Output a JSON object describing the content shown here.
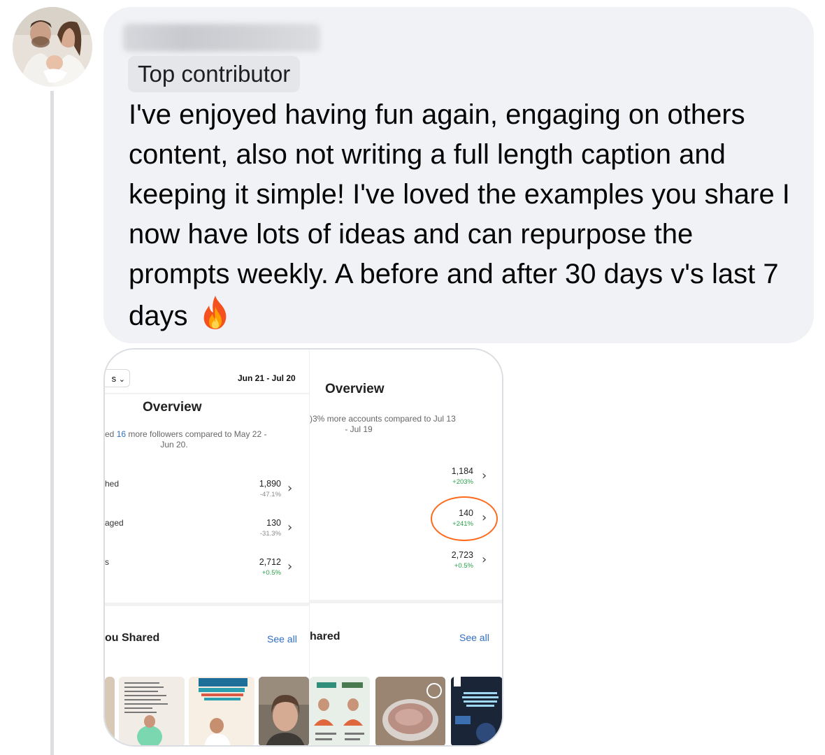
{
  "comment": {
    "badge": "Top contributor",
    "text": "I've enjoyed having fun again, engaging on others content, also not writing a full length caption and keeping it simple! I've loved the examples you share I now have lots of ideas and can repurpose the prompts weekly. A before and after 30 days v's last 7 days",
    "emoji_icon": "fire-icon",
    "bubble_color": "#f0f2f5"
  },
  "screenshot_left": {
    "dropdown_text": "s",
    "date_range": "Jun 21 - Jul 20",
    "overview": "Overview",
    "subtitle_prefix": "ed ",
    "subtitle_number": "16",
    "subtitle_rest": " more followers compared to May 22 -",
    "subtitle_line2": "Jun 20.",
    "rows": [
      {
        "label": "hed",
        "value": "1,890",
        "change": "-47.1%"
      },
      {
        "label": "aged",
        "value": "130",
        "change": "-31.3%"
      },
      {
        "label": "s",
        "value": "2,712",
        "change": "+0.5%"
      }
    ],
    "section_title": "ou Shared",
    "see_all": "See all"
  },
  "screenshot_right": {
    "overview": "Overview",
    "subtitle_prefix": ")3%",
    "subtitle_rest": " more accounts compared to Jul 13",
    "subtitle_line2": "- Jul 19",
    "rows": [
      {
        "value": "1,184",
        "change": "+203%"
      },
      {
        "value": "140",
        "change": "+241%"
      },
      {
        "value": "2,723",
        "change": "+0.5%"
      }
    ],
    "section_title": "hared",
    "see_all": "See all"
  },
  "highlight_color": "#ff6a1f"
}
